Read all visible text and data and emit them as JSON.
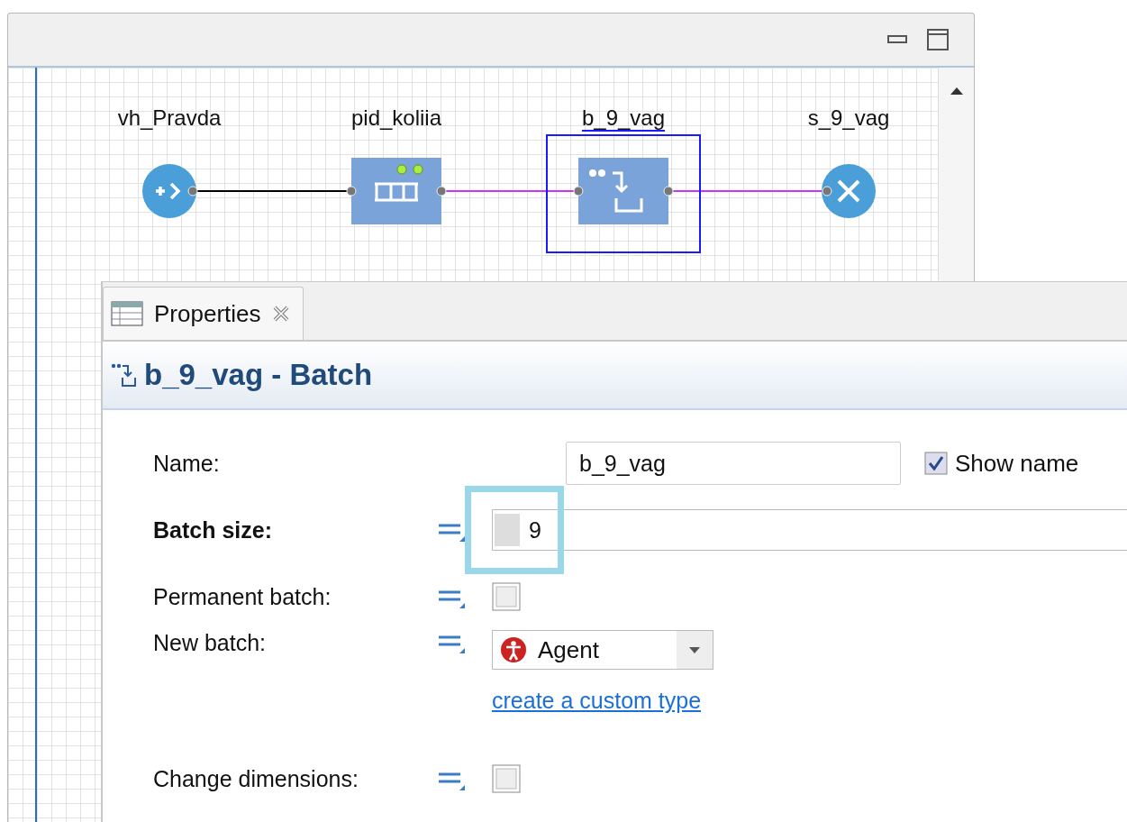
{
  "diagram": {
    "nodes": [
      {
        "name": "vh_Pravda",
        "kind": "source",
        "selected": false
      },
      {
        "name": "pid_koliia",
        "kind": "queue",
        "selected": false
      },
      {
        "name": "b_9_vag",
        "kind": "batch",
        "selected": true
      },
      {
        "name": "s_9_vag",
        "kind": "sink",
        "selected": false
      }
    ],
    "connections": [
      {
        "color": "#000000"
      },
      {
        "color": "#cc33ff"
      },
      {
        "color": "#cc33ff"
      }
    ]
  },
  "properties": {
    "tab": {
      "label": "Properties",
      "selected": true
    },
    "title": "b_9_vag - Batch",
    "rows": [
      {
        "kind": "name",
        "label": "Name:",
        "bold": false,
        "value": "b_9_vag",
        "checkbox_label": "Show name",
        "checked": true
      },
      {
        "kind": "code",
        "label": "Batch size:",
        "bold": true,
        "value": "9",
        "highlighted": true
      },
      {
        "kind": "checkbox",
        "label": "Permanent batch:",
        "bold": false,
        "checked": false
      },
      {
        "kind": "dropdown",
        "label": "New batch:",
        "bold": false,
        "value": "Agent",
        "link": "create a custom type"
      },
      {
        "kind": "checkbox",
        "label": "Change dimensions:",
        "bold": false,
        "checked": false
      }
    ]
  }
}
